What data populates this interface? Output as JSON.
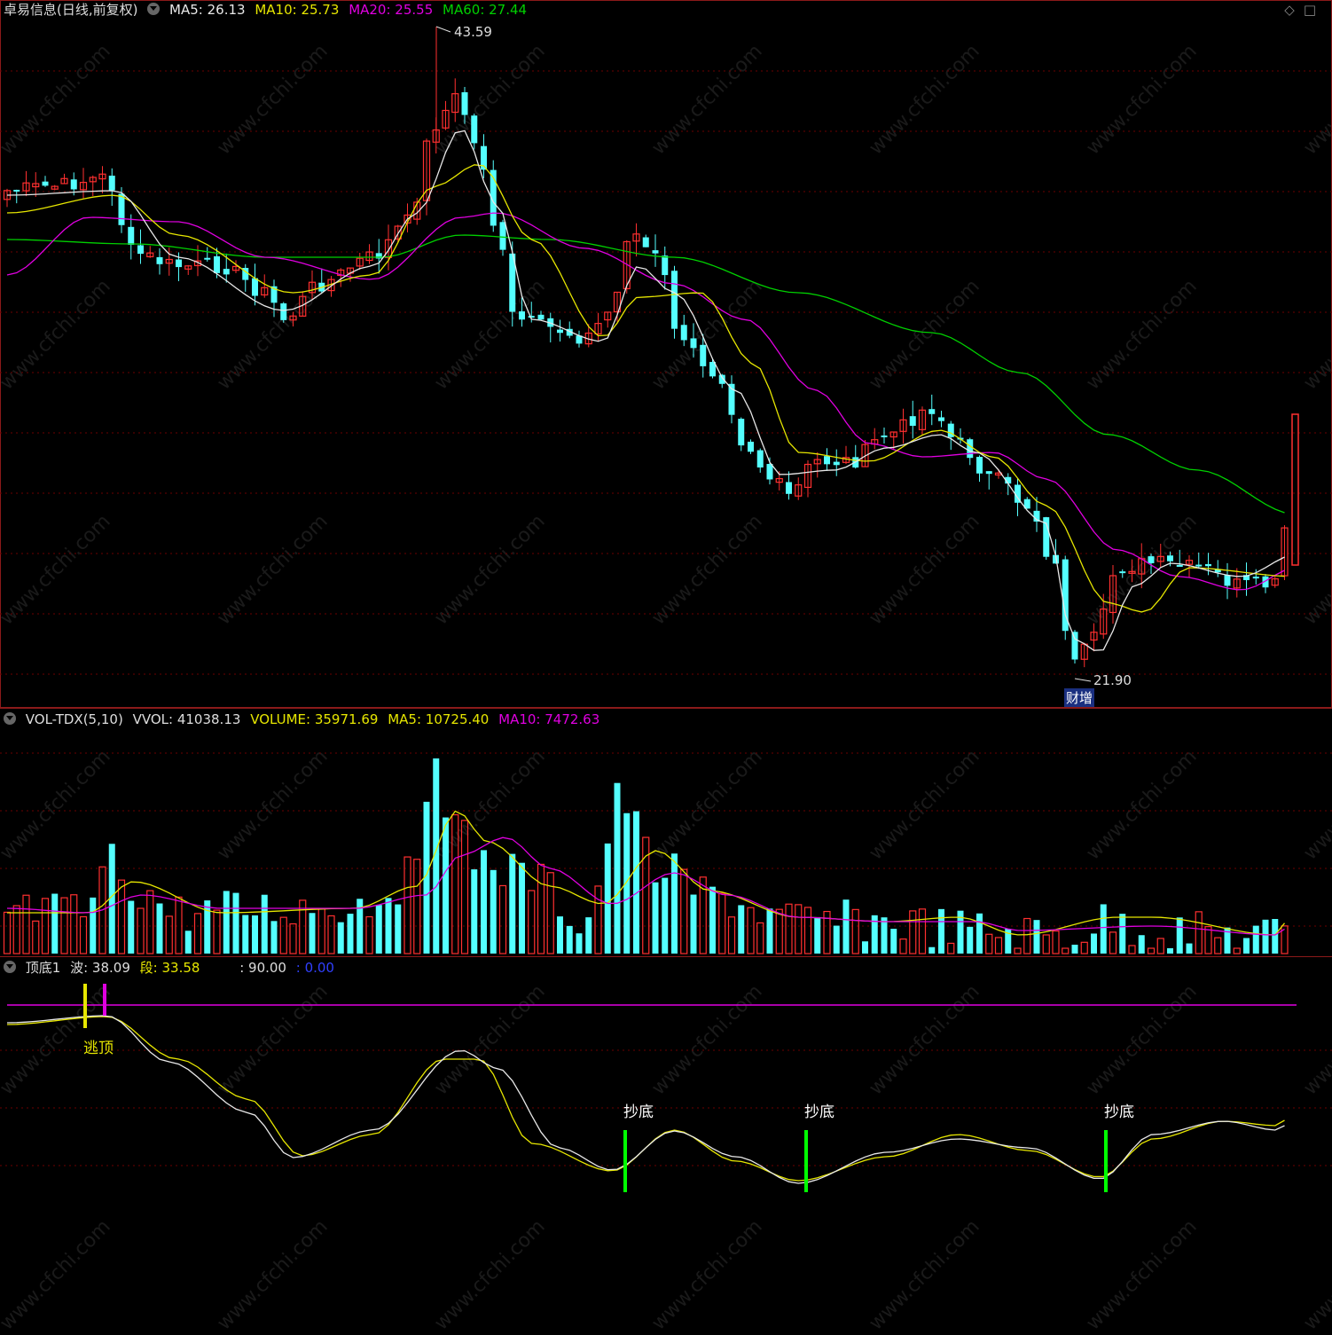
{
  "price_panel": {
    "title": "卓易信息(日线,前复权)",
    "indicators": [
      {
        "label": "MA5: 26.13",
        "color": "#e8e8e8"
      },
      {
        "label": "MA10: 25.73",
        "color": "#e6e600"
      },
      {
        "label": "MA20: 25.55",
        "color": "#e000e0"
      },
      {
        "label": "MA60: 27.44",
        "color": "#00d000"
      }
    ],
    "high_label": "43.59",
    "low_label": "21.90",
    "event_tag": "财增"
  },
  "volume_panel": {
    "title": "VOL-TDX(5,10)",
    "indicators": [
      {
        "label": "VVOL: 41038.13",
        "color": "#dddddd"
      },
      {
        "label": "VOLUME: 35971.69",
        "color": "#e6e600"
      },
      {
        "label": "MA5: 10725.40",
        "color": "#e6e600"
      },
      {
        "label": "MA10: 7472.63",
        "color": "#e000e0"
      }
    ]
  },
  "signal_panel": {
    "title": "顶底1",
    "indicators": [
      {
        "label": "波: 38.09",
        "color": "#dddddd"
      },
      {
        "label": "段: 33.58",
        "color": "#e6e600"
      },
      {
        "label": ": 90.00",
        "color": "#dddddd"
      },
      {
        "label": ": 0.00",
        "color": "#3040ff"
      }
    ],
    "top_signal": "逃顶",
    "bottom_signal": "抄底"
  },
  "watermark": "www.cfchi.com",
  "icons": [
    "diamond-icon",
    "maximize-icon"
  ],
  "colors": {
    "up": "#ff3030",
    "down": "#54ffff",
    "border": "#8b1a1a"
  }
}
